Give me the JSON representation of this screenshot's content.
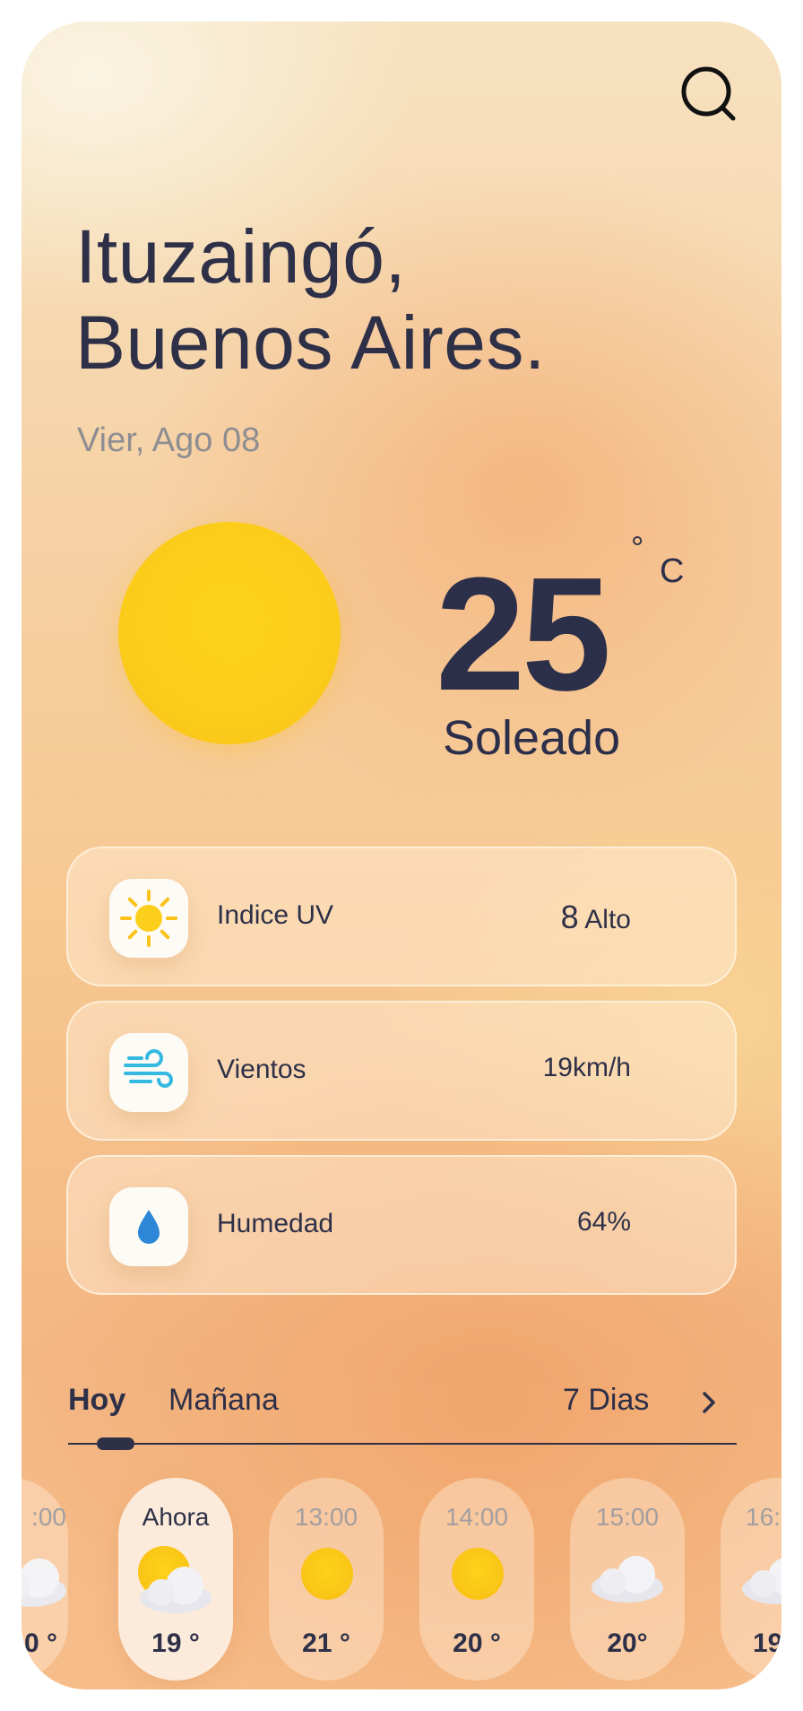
{
  "header": {
    "location_line1": "Ituzaingó,",
    "location_line2": "Buenos Aires.",
    "date": "Vier, Ago 08",
    "search_icon": "search-icon"
  },
  "current": {
    "temperature": "25",
    "degree_symbol": "°",
    "unit": "C",
    "condition": "Soleado",
    "icon": "sun-icon"
  },
  "details": [
    {
      "label": "Indice UV",
      "value_number": "8",
      "value_text": "Alto",
      "icon": "sun-icon"
    },
    {
      "label": "Vientos",
      "value": "19km/h",
      "icon": "wind-icon"
    },
    {
      "label": "Humedad",
      "value": "64%",
      "icon": "water-drop-icon"
    }
  ],
  "tabs": {
    "today": "Hoy",
    "tomorrow": "Mañana",
    "week": "7 Dias",
    "active": "Hoy"
  },
  "hourly": [
    {
      "time": ":00",
      "temp": "0 °",
      "icon": "cloud-icon"
    },
    {
      "time": "Ahora",
      "temp": "19 °",
      "icon": "partly-cloudy-icon"
    },
    {
      "time": "13:00",
      "temp": "21 °",
      "icon": "sun-icon"
    },
    {
      "time": "14:00",
      "temp": "20 °",
      "icon": "sun-icon"
    },
    {
      "time": "15:00",
      "temp": "20°",
      "icon": "cloud-icon"
    },
    {
      "time": "16:",
      "temp": "19",
      "icon": "cloud-icon"
    }
  ],
  "colors": {
    "text_dark": "#2e3048",
    "text_muted": "#8e8e92",
    "sun": "#fbcd1a",
    "wind": "#35b9e0",
    "drop": "#2e86d6"
  }
}
